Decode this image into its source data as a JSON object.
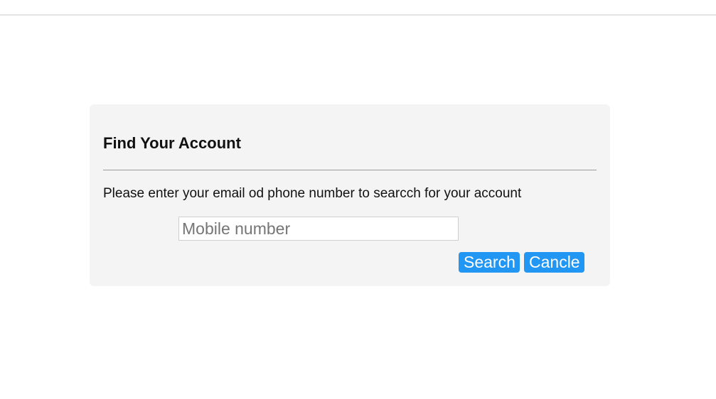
{
  "dialog": {
    "title": "Find Your Account",
    "instructions": "Please enter your email od phone number to searcch for your account",
    "mobile_input": {
      "value": "",
      "placeholder": "Mobile number"
    },
    "search_label": "Search",
    "cancel_label": "Cancle"
  },
  "colors": {
    "card_background": "#f4f4f4",
    "button_accent": "#2196f3"
  }
}
